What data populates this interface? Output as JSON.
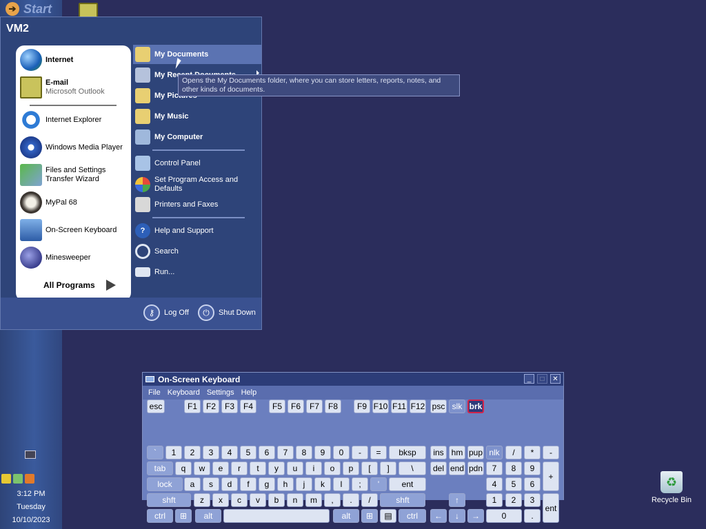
{
  "taskbar": {
    "start_label": "Start",
    "clock": {
      "time": "3:12 PM",
      "day": "Tuesday",
      "date": "10/10/2023"
    }
  },
  "desktop": {
    "recycle_bin_label": "Recycle Bin"
  },
  "start_menu": {
    "user": "VM2",
    "pinned": [
      {
        "label": "Internet",
        "icon": "globe-icon"
      },
      {
        "label": "E-mail",
        "sub": "Microsoft Outlook",
        "icon": "outlook-icon"
      }
    ],
    "recent": [
      {
        "label": "Internet Explorer",
        "icon": "ie-icon"
      },
      {
        "label": "Windows Media Player",
        "icon": "media-player-icon"
      },
      {
        "label": "Files and Settings Transfer Wizard",
        "icon": "transfer-wizard-icon"
      },
      {
        "label": "MyPal 68",
        "icon": "mypal-icon"
      },
      {
        "label": "On-Screen Keyboard",
        "icon": "keyboard-icon"
      },
      {
        "label": "Minesweeper",
        "icon": "mine-icon"
      }
    ],
    "all_programs": "All Programs",
    "right": [
      {
        "label": "My Documents",
        "icon": "folder-docs-icon",
        "bold": true,
        "selected": true
      },
      {
        "label": "My Recent Documents",
        "icon": "recent-docs-icon",
        "bold": true
      },
      {
        "label": "My Pictures",
        "icon": "folder-pictures-icon",
        "bold": true
      },
      {
        "label": "My Music",
        "icon": "folder-music-icon",
        "bold": true
      },
      {
        "label": "My Computer",
        "icon": "computer-icon",
        "bold": true
      },
      {
        "label": "Control Panel",
        "icon": "control-panel-icon"
      },
      {
        "label": "Set Program Access and Defaults",
        "icon": "program-access-icon"
      },
      {
        "label": "Printers and Faxes",
        "icon": "printer-icon"
      },
      {
        "label": "Help and Support",
        "icon": "help-icon"
      },
      {
        "label": "Search",
        "icon": "search-icon"
      },
      {
        "label": "Run...",
        "icon": "run-icon"
      }
    ],
    "log_off": "Log Off",
    "shut_down": "Shut Down",
    "tooltip": "Opens the My Documents folder, where you can store letters, reports, notes, and other kinds of documents."
  },
  "osk": {
    "title": "On-Screen Keyboard",
    "menu": [
      "File",
      "Keyboard",
      "Settings",
      "Help"
    ],
    "rows": {
      "fn": [
        "esc",
        "F1",
        "F2",
        "F3",
        "F4",
        "F5",
        "F6",
        "F7",
        "F8",
        "F9",
        "F10",
        "F11",
        "F12",
        "psc",
        "slk",
        "brk"
      ],
      "num": [
        "`",
        "1",
        "2",
        "3",
        "4",
        "5",
        "6",
        "7",
        "8",
        "9",
        "0",
        "-",
        "=",
        "bksp",
        "ins",
        "hm",
        "pup",
        "nlk",
        "/",
        "*",
        "-"
      ],
      "tab": [
        "tab",
        "q",
        "w",
        "e",
        "r",
        "t",
        "y",
        "u",
        "i",
        "o",
        "p",
        "[",
        "]",
        "\\",
        "del",
        "end",
        "pdn",
        "7",
        "8",
        "9",
        "+"
      ],
      "caps": [
        "lock",
        "a",
        "s",
        "d",
        "f",
        "g",
        "h",
        "j",
        "k",
        "l",
        ";",
        "'",
        "ent",
        "4",
        "5",
        "6"
      ],
      "shift": [
        "shft",
        "z",
        "x",
        "c",
        "v",
        "b",
        "n",
        "m",
        ",",
        ".",
        "/",
        "shft",
        "↑",
        "1",
        "2",
        "3",
        "ent"
      ],
      "bottom": [
        "ctrl",
        "⊞",
        "alt",
        "",
        "alt",
        "⊞",
        "▤",
        "ctrl",
        "←",
        "↓",
        "→",
        "0",
        "."
      ]
    }
  }
}
